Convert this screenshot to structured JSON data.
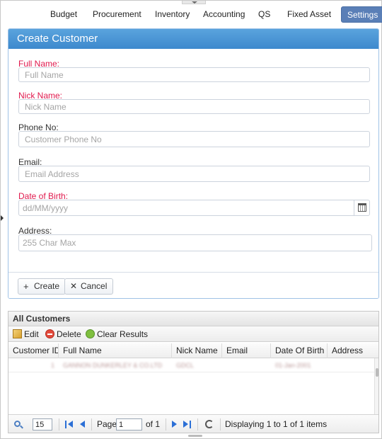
{
  "nav": {
    "items": [
      {
        "label": "Budget",
        "active": false
      },
      {
        "label": "Procurement",
        "active": false
      },
      {
        "label": "Inventory",
        "active": false
      },
      {
        "label": "Accounting",
        "active": false
      },
      {
        "label": "QS",
        "active": false
      },
      {
        "label": "Fixed Asset",
        "active": false
      },
      {
        "label": "Settings",
        "active": true
      }
    ]
  },
  "form": {
    "title": "Create Customer",
    "full_name": {
      "label": "Full Name:",
      "placeholder": "Full Name",
      "value": ""
    },
    "nick_name": {
      "label": "Nick Name:",
      "placeholder": "Nick Name",
      "value": ""
    },
    "phone": {
      "label": "Phone No:",
      "placeholder": "Customer Phone No",
      "value": ""
    },
    "email": {
      "label": "Email:",
      "placeholder": "Email Address",
      "value": ""
    },
    "dob": {
      "label": "Date of Birth:",
      "placeholder": "dd/MM/yyyy",
      "value": ""
    },
    "address": {
      "label": "Address:",
      "placeholder": "255 Char Max",
      "value": ""
    },
    "create_label": "Create",
    "cancel_label": "Cancel"
  },
  "grid": {
    "title": "All Customers",
    "toolbar": {
      "edit": "Edit",
      "delete": "Delete",
      "clear": "Clear Results"
    },
    "columns": [
      "Customer ID",
      "Full Name",
      "Nick Name",
      "Email",
      "Date Of Birth",
      "Address"
    ],
    "rows": [
      {
        "id": "1",
        "full_name": "GANNON DUNKERLEY & CO.LTD",
        "nick_name": "GDCL",
        "email": "",
        "dob": "01-Jan-2001",
        "address": ""
      }
    ],
    "pager": {
      "page_size": "15",
      "page_label": "Page",
      "page_value": "1",
      "of_label": "of 1",
      "display": "Displaying 1 to 1 of 1 items"
    }
  },
  "colors": {
    "accent": "#3d89cd",
    "required": "#e0194d",
    "active_nav": "#5a7fb7"
  }
}
